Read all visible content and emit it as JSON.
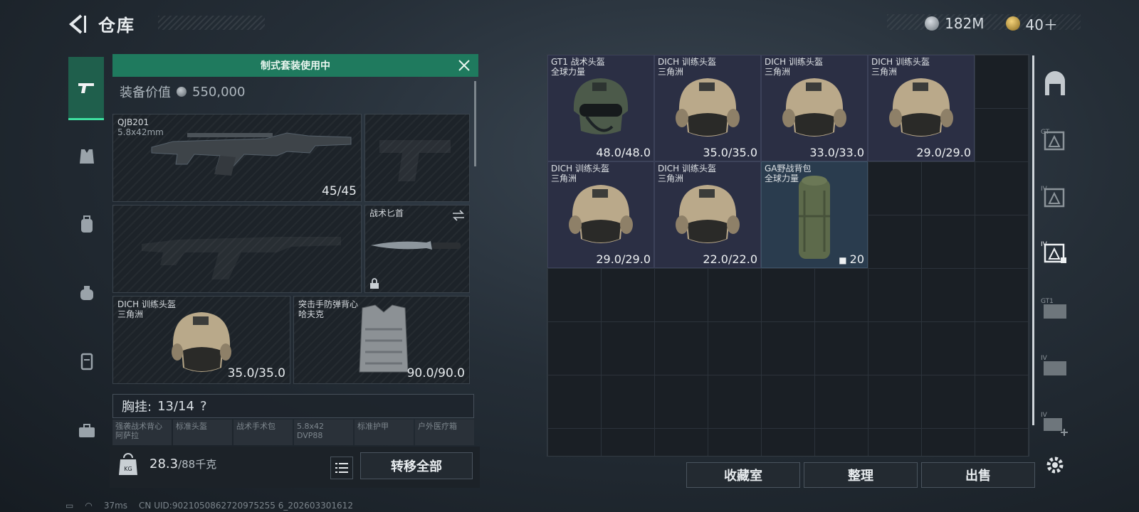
{
  "header": {
    "title": "仓库"
  },
  "currency": {
    "money": "182M",
    "tokens": "40＋"
  },
  "left_panel": {
    "banner": "制式套装使用中",
    "value_label": "装备价值",
    "value": "550,000",
    "slots": {
      "primary": {
        "name": "QJB201",
        "sub": "5.8x42mm",
        "value": "45/45"
      },
      "knife": {
        "name": "战术匕首"
      },
      "helmet": {
        "name": "DICH 训练头盔",
        "sub": "三角洲",
        "value": "35.0/35.0"
      },
      "armor": {
        "name": "突击手防弹背心",
        "sub": "哈夫克",
        "value": "90.0/90.0"
      }
    },
    "chest_rig": {
      "label": "胸挂:",
      "count": "13/14",
      "help": "?"
    },
    "sub_slots": [
      {
        "line1": "强袭战术背心",
        "line2": "阿萨拉"
      },
      {
        "line1": "标准头盔",
        "line2": ""
      },
      {
        "line1": "战术手术包",
        "line2": ""
      },
      {
        "line1": "5.8x42",
        "line2": "DVP88"
      },
      {
        "line1": "标准护甲",
        "line2": ""
      },
      {
        "line1": "户外医疗箱",
        "line2": ""
      }
    ],
    "weight": {
      "current": "28.3",
      "max": "/88千克"
    },
    "transfer_all": "转移全部"
  },
  "stash": {
    "items": [
      {
        "name": "GT1 战术头盔",
        "sub": "全球力量",
        "value": "48.0/48.0",
        "kind": "gt1"
      },
      {
        "name": "DICH 训练头盔",
        "sub": "三角洲",
        "value": "35.0/35.0",
        "kind": "dich"
      },
      {
        "name": "DICH 训练头盔",
        "sub": "三角洲",
        "value": "33.0/33.0",
        "kind": "dich"
      },
      {
        "name": "DICH 训练头盔",
        "sub": "三角洲",
        "value": "29.0/29.0",
        "kind": "dich"
      },
      {
        "name": "DICH 训练头盔",
        "sub": "三角洲",
        "value": "29.0/29.0",
        "kind": "dich"
      },
      {
        "name": "DICH 训练头盔",
        "sub": "三角洲",
        "value": "22.0/22.0",
        "kind": "dich"
      },
      {
        "name": "GA野战背包",
        "sub": "全球力量",
        "value": "20",
        "kind": "bag"
      }
    ]
  },
  "bottom": {
    "collection": "收藏室",
    "sort": "整理",
    "sell": "出售"
  },
  "status": {
    "ping": "37ms",
    "uid": "CN UID:9021050862720975255 6_202603301612"
  },
  "colors": {
    "banner": "#1f7a5e",
    "item_bg": "#2b2f44"
  }
}
